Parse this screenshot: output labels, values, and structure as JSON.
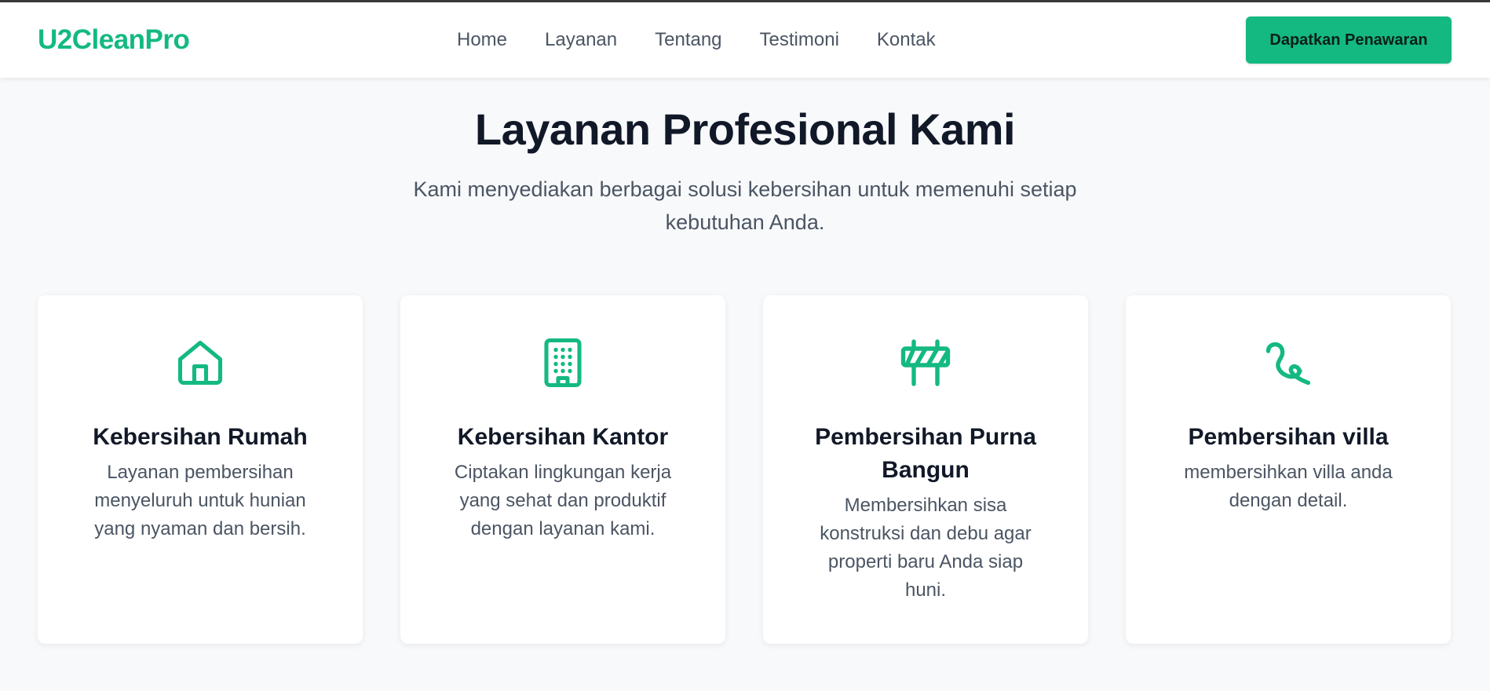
{
  "header": {
    "logo": "U2CleanPro",
    "nav": [
      "Home",
      "Layanan",
      "Tentang",
      "Testimoni",
      "Kontak"
    ],
    "cta_label": "Dapatkan Penawaran"
  },
  "section": {
    "title": "Layanan Profesional Kami",
    "subtitle": "Kami menyediakan berbagai solusi kebersihan untuk memenuhi setiap kebutuhan Anda."
  },
  "cards": [
    {
      "icon": "house-icon",
      "title": "Kebersihan Rumah",
      "description": "Layanan pembersihan menyeluruh untuk hunian yang nyaman dan bersih."
    },
    {
      "icon": "office-building-icon",
      "title": "Kebersihan Kantor",
      "description": "Ciptakan lingkungan kerja yang sehat dan produktif dengan layanan kami."
    },
    {
      "icon": "construction-barrier-icon",
      "title": "Pembersihan Purna Bangun",
      "description": "Membersihkan sisa konstruksi dan debu agar properti baru Anda siap huni."
    },
    {
      "icon": "squiggle-icon",
      "title": "Pembersihan villa",
      "description": "membersihkan villa anda dengan detail."
    }
  ],
  "colors": {
    "brand": "#14b981",
    "text_dark": "#111827",
    "text_muted": "#4b5563",
    "background": "#f8f9fb"
  }
}
